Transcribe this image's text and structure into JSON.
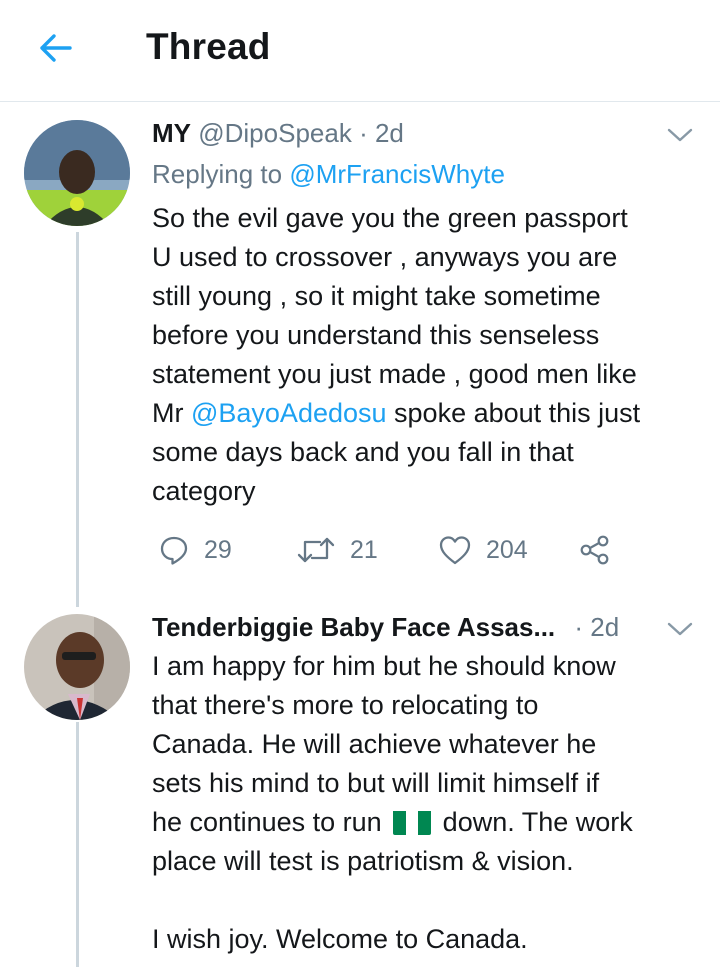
{
  "header": {
    "title": "Thread",
    "back_icon": "arrow-left-icon"
  },
  "tweets": [
    {
      "name": "MY",
      "handle": "@DipoSpeak",
      "separator": "·",
      "time": "2d",
      "replying_prefix": "Replying to ",
      "replying_to": "@MrFrancisWhyte",
      "lines": [
        "So the evil gave you the green passport",
        "U used to crossover , anyways you are",
        "still young , so it might take sometime",
        "before you understand this senseless",
        "statement you just made , good men like",
        {
          "pre": "Mr ",
          "mention": "@BayoAdedosu",
          "post": " spoke about this just"
        },
        "some days back and you fall in that",
        "category"
      ],
      "stats": {
        "replies": "29",
        "retweets": "21",
        "likes": "204"
      }
    },
    {
      "name": "Tenderbiggie Baby Face Assas...",
      "separator": "·",
      "time": "2d",
      "lines": [
        "I am happy for him but he should know",
        "that there's more to relocating to",
        "Canada. He will achieve whatever he",
        "sets his mind to but will limit himself if",
        {
          "pre": "he continues to run ",
          "flag": "nigeria-flag-icon",
          "post": " down. The work"
        },
        "place will test is patriotism & vision.",
        "",
        "I wish joy. Welcome to Canada."
      ]
    }
  ],
  "colors": {
    "accent": "#1da1f2",
    "text": "#14171a",
    "muted": "#657786",
    "line": "#ccd6dd",
    "flag_green": "#008751"
  }
}
